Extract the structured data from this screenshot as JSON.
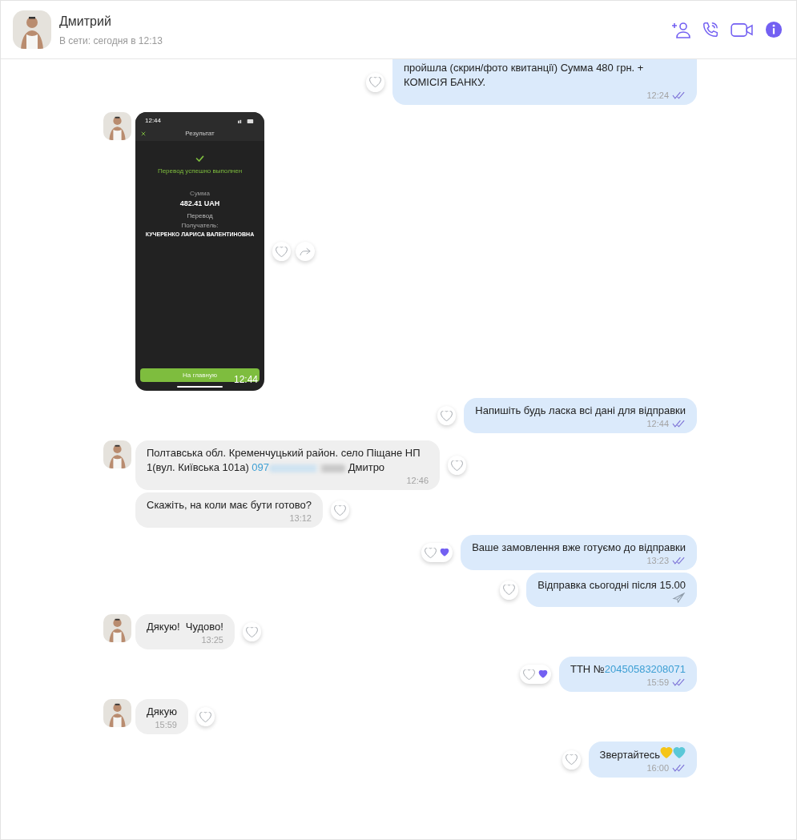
{
  "header": {
    "name": "Дмитрий",
    "status": "В сети: сегодня в 12:13"
  },
  "messages": [
    {
      "outgoing": true,
      "kind": "text",
      "parts": [
        {
          "kind": "plain",
          "text": "пройшла (скрин/фото квитанції) Сумма 480 грн. + КОМІСІЯ БАНКУ."
        }
      ],
      "time": "12:24",
      "read": true,
      "liked": false,
      "clipped": true
    },
    {
      "outgoing": false,
      "kind": "image",
      "avatar": true,
      "screen": {
        "clock": "12:44",
        "title": "Результат",
        "result": "Перевод успешно выполнен",
        "amount_label": "Сумма",
        "amount": "482.41 UAH",
        "type": "Перевод",
        "recipient_label": "Получатель:",
        "recipient": "КУЧЕРЕНКО ЛАРИСА ВАЛЕНТИНОВНА",
        "button": "На главную"
      },
      "time": "12:44",
      "liked": false,
      "forward": true
    },
    {
      "outgoing": true,
      "kind": "text",
      "parts": [
        {
          "kind": "plain",
          "text": "Напишіть будь ласка всі дані для відправки"
        }
      ],
      "time": "12:44",
      "read": true,
      "liked": false
    },
    {
      "outgoing": false,
      "kind": "text",
      "avatar": true,
      "parts": [
        {
          "kind": "plain",
          "text": "Полтавська обл. Кременчуцький район. село Піщане НП 1(вул. Київська 101а) "
        },
        {
          "kind": "link",
          "text": "097"
        },
        {
          "kind": "redacted"
        },
        {
          "kind": "plain",
          "text": " Дмитро"
        }
      ],
      "time": "12:46",
      "liked": false
    },
    {
      "outgoing": false,
      "kind": "text",
      "avatar": false,
      "parts": [
        {
          "kind": "plain",
          "text": "Скажіть, на коли має бути готово?"
        }
      ],
      "time": "13:12",
      "liked": false
    },
    {
      "outgoing": true,
      "kind": "text",
      "parts": [
        {
          "kind": "plain",
          "text": "Ваше замовлення вже готуємо до відправки"
        }
      ],
      "time": "13:23",
      "read": true,
      "liked": true
    },
    {
      "outgoing": true,
      "kind": "text",
      "parts": [
        {
          "kind": "plain",
          "text": "Відправка сьогодні після 15.00"
        }
      ],
      "read": false,
      "liked": false
    },
    {
      "outgoing": false,
      "kind": "text",
      "avatar": true,
      "parts": [
        {
          "kind": "plain",
          "text": "Дякую!  Чудово!"
        }
      ],
      "time": "13:25",
      "liked": false
    },
    {
      "outgoing": true,
      "kind": "text",
      "parts": [
        {
          "kind": "plain",
          "text": "ТТН №"
        },
        {
          "kind": "link",
          "text": "20450583208071"
        }
      ],
      "time": "15:59",
      "read": true,
      "liked": true
    },
    {
      "outgoing": false,
      "kind": "text",
      "avatar": true,
      "parts": [
        {
          "kind": "plain",
          "text": "Дякую"
        }
      ],
      "time": "15:59",
      "liked": false
    },
    {
      "outgoing": true,
      "kind": "text",
      "parts": [
        {
          "kind": "plain",
          "text": "Звертайтесь"
        },
        {
          "kind": "heart",
          "color": "#f5c518"
        },
        {
          "kind": "heart",
          "color": "#5bc8d8"
        }
      ],
      "time": "16:00",
      "read": true,
      "liked": false
    }
  ]
}
